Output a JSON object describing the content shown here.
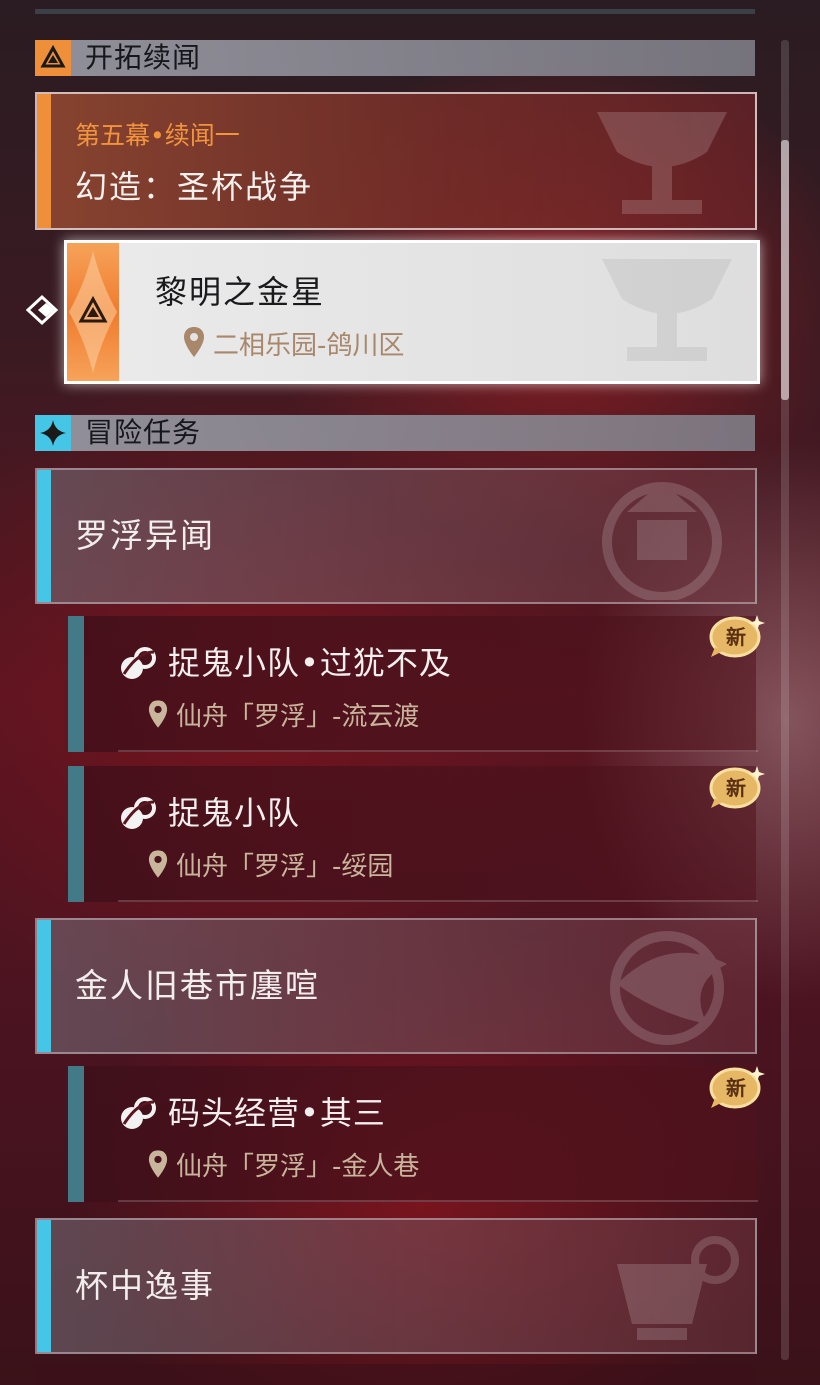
{
  "sections": {
    "trailblaze_continuance": "开拓续闻",
    "adventure_missions": "冒险任务"
  },
  "trail_card": {
    "subtitle": "第五幕•续闻一",
    "title": "幻造：圣杯战争"
  },
  "selected_quest": {
    "title": "黎明之金星",
    "location": "二相乐园-鸽川区"
  },
  "regions": [
    {
      "title": "罗浮异闻",
      "quests": [
        {
          "title": "捉鬼小队•过犹不及",
          "location": "仙舟「罗浮」-流云渡",
          "badge": "新"
        },
        {
          "title": "捉鬼小队",
          "location": "仙舟「罗浮」-绥园",
          "badge": "新"
        }
      ]
    },
    {
      "title": "金人旧巷市廛喧",
      "quests": [
        {
          "title": "码头经营•其三",
          "location": "仙舟「罗浮」-金人巷",
          "badge": "新"
        }
      ]
    },
    {
      "title": "杯中逸事",
      "quests": []
    }
  ],
  "colors": {
    "trailblaze_accent": "#f08f3a",
    "region_accent": "#46c6e6",
    "quest_accent": "#437a87",
    "location_text": "#c9b59c"
  },
  "icons": {
    "trailblaze": "triangle-emblem-icon",
    "adventure": "four-point-star-icon",
    "quest": "adventure-mission-icon",
    "location": "map-pin-icon",
    "new": "new-badge-icon",
    "tracking": "tracking-arrow-icon"
  }
}
